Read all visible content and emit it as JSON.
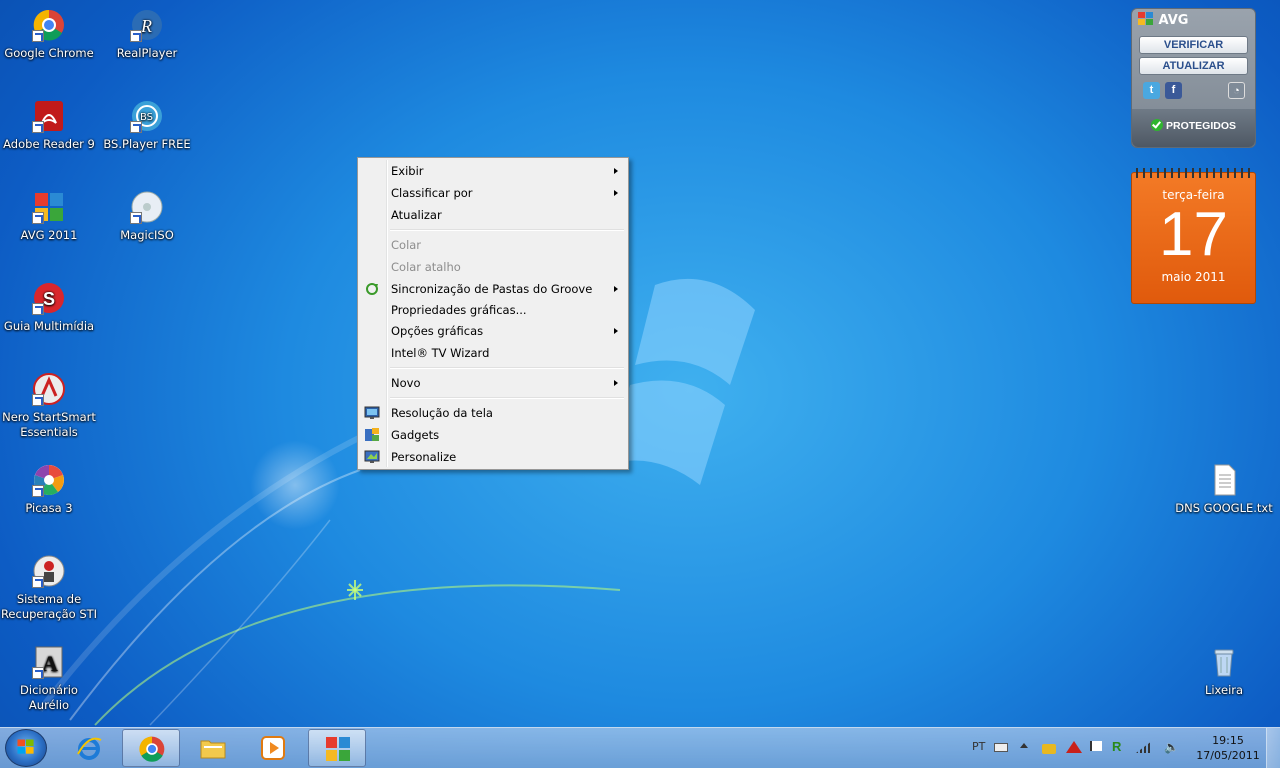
{
  "desktop": {
    "left_icons": [
      {
        "label": "Google Chrome",
        "icon": "chrome-icon"
      },
      {
        "label": "RealPlayer",
        "icon": "realplayer-icon"
      },
      {
        "label": "Adobe Reader 9",
        "icon": "adobe-reader-icon"
      },
      {
        "label": "BS.Player FREE",
        "icon": "bsplayer-icon"
      },
      {
        "label": "AVG 2011",
        "icon": "avg-icon"
      },
      {
        "label": "MagicISO",
        "icon": "magiciso-icon"
      },
      {
        "label": "Guia Multimídia",
        "icon": "guia-multimidia-icon"
      },
      {
        "label": "Nero StartSmart Essentials",
        "icon": "nero-icon"
      },
      {
        "label": "Picasa 3",
        "icon": "picasa-icon"
      },
      {
        "label": "Sistema de Recuperação STI",
        "icon": "recovery-icon"
      },
      {
        "label": "Dicionário Aurélio",
        "icon": "dictionary-icon"
      }
    ],
    "right_icons": [
      {
        "label": "DNS GOOGLE.txt",
        "icon": "text-file-icon"
      },
      {
        "label": "Lixeira",
        "icon": "recycle-bin-icon"
      }
    ]
  },
  "context_menu": {
    "items": [
      {
        "label": "Exibir",
        "submenu": true
      },
      {
        "label": "Classificar por",
        "submenu": true
      },
      {
        "label": "Atualizar"
      },
      {
        "label": "Colar",
        "disabled": true
      },
      {
        "label": "Colar atalho",
        "disabled": true
      },
      {
        "label": "Sincronização de Pastas do Groove",
        "submenu": true,
        "icon": "groove-sync-icon"
      },
      {
        "label": "Propriedades gráficas..."
      },
      {
        "label": "Opções gráficas",
        "submenu": true
      },
      {
        "label": "Intel® TV Wizard"
      },
      {
        "label": "Novo",
        "submenu": true
      },
      {
        "label": "Resolução da tela",
        "icon": "display-icon"
      },
      {
        "label": "Gadgets",
        "icon": "gadgets-icon"
      },
      {
        "label": "Personalize",
        "icon": "personalize-icon"
      }
    ]
  },
  "avg_gadget": {
    "title": "AVG",
    "verify_label": "VERIFICAR",
    "update_label": "ATUALIZAR",
    "status_label": "PROTEGIDOS",
    "socials": [
      "twitter-icon",
      "facebook-icon",
      "avg-settings-icon"
    ]
  },
  "calendar_gadget": {
    "weekday": "terça-feira",
    "day": "17",
    "month_year": "maio 2011"
  },
  "taskbar": {
    "pinned": [
      "internet-explorer-icon",
      "chrome-icon",
      "explorer-folder-icon",
      "media-player-icon",
      "avg-icon"
    ],
    "language": "PT",
    "time": "19:15",
    "date": "17/05/2011"
  },
  "colors": {
    "desktop_blue": "#1e8ae0",
    "calendar_orange": "#f0701c",
    "menu_bg": "#f0f0f0"
  }
}
